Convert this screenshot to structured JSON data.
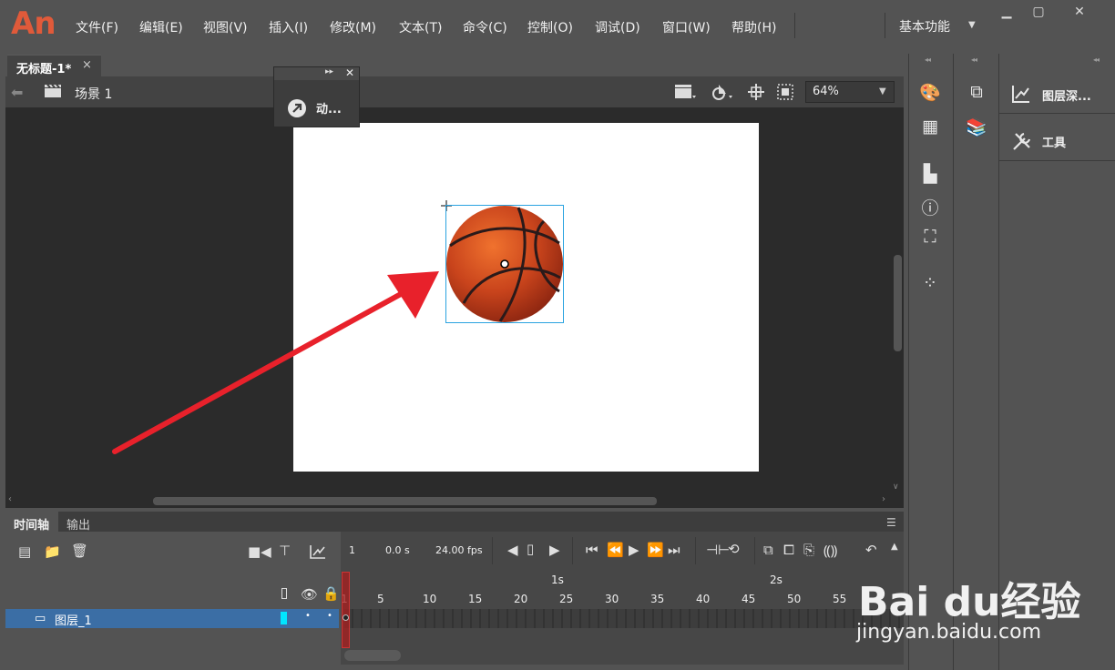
{
  "app": {
    "logo": "An"
  },
  "menu": {
    "items": [
      "文件(F)",
      "编辑(E)",
      "视图(V)",
      "插入(I)",
      "修改(M)",
      "文本(T)",
      "命令(C)",
      "控制(O)",
      "调试(D)",
      "窗口(W)",
      "帮助(H)"
    ],
    "workspace": "基本功能"
  },
  "document": {
    "tab_title": "无标题-1*",
    "close": "×"
  },
  "scene": {
    "name": "场景 1",
    "zoom": "64%"
  },
  "float_panel": {
    "label": "动..."
  },
  "right_panel": {
    "layer_depth": "图层深...",
    "tools": "工具"
  },
  "timeline": {
    "tabs": [
      "时间轴",
      "输出"
    ],
    "current_frame": "1",
    "time": "0.0 s",
    "fps": "24.00 fps",
    "ruler_seconds": [
      "1s",
      "2s"
    ],
    "ruler_frames": [
      "1",
      "5",
      "10",
      "15",
      "20",
      "25",
      "30",
      "35",
      "40",
      "45",
      "50",
      "55"
    ],
    "layer_name": "图层_1"
  },
  "watermark": {
    "brand": "Bai du经验",
    "url": "jingyan.baidu.com"
  },
  "colors": {
    "arrow": "#e8212b",
    "selection": "#2aa3e0",
    "layer_highlight": "#3b6ea5",
    "layer_color_chip": "#00e5ff"
  }
}
